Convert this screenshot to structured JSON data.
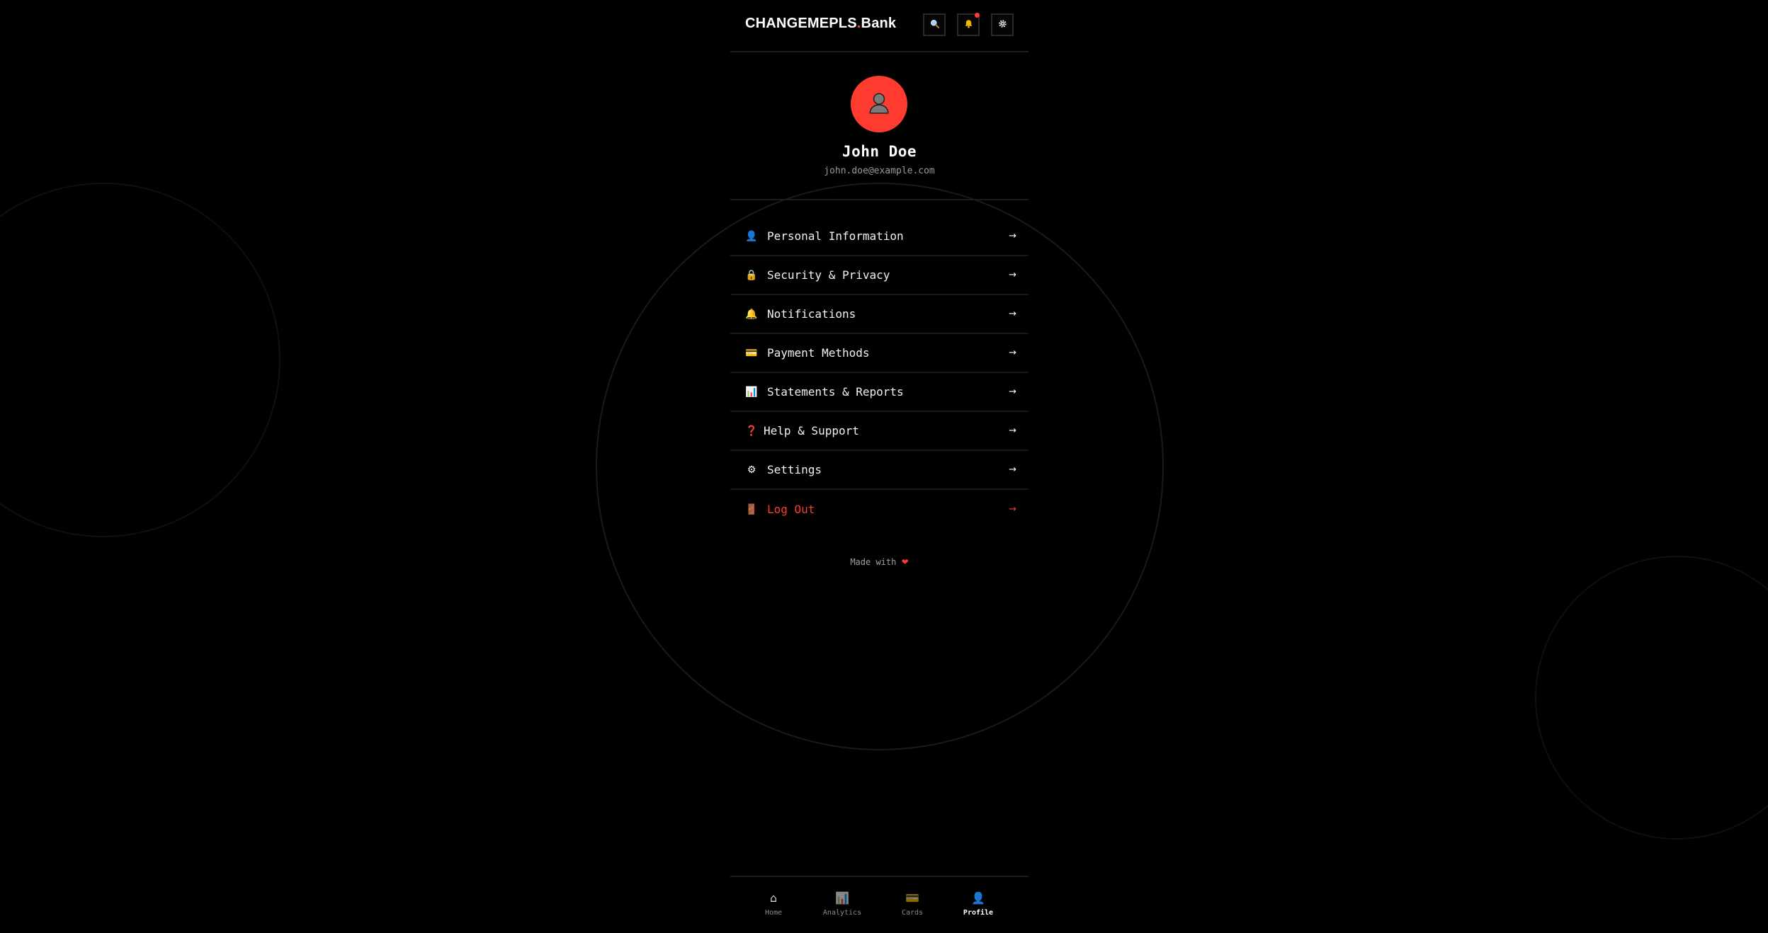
{
  "header": {
    "brand_main": "CHANGEMEPLS",
    "brand_dot": ".",
    "brand_suffix": "Bank",
    "search_icon": "search-icon",
    "notification_icon": "bell-icon",
    "settings_icon": "gear-icon"
  },
  "profile": {
    "name": "John Doe",
    "email": "john.doe@example.com",
    "avatar_icon": "user-silhouette-icon"
  },
  "menu": {
    "items": [
      {
        "label": "Personal Information",
        "icon": "user-icon",
        "glyph": "👤"
      },
      {
        "label": "Security & Privacy",
        "icon": "lock-icon",
        "glyph": "🔒"
      },
      {
        "label": "Notifications",
        "icon": "bell-icon",
        "glyph": "🔔"
      },
      {
        "label": "Payment Methods",
        "icon": "credit-card-icon",
        "glyph": "💳"
      },
      {
        "label": "Statements & Reports",
        "icon": "bar-chart-icon",
        "glyph": "📊"
      },
      {
        "label": "Help & Support",
        "icon": "question-icon",
        "glyph": "❓"
      },
      {
        "label": "Settings",
        "icon": "gear-icon",
        "glyph": "⚙"
      },
      {
        "label": "Log Out",
        "icon": "door-icon",
        "glyph": "🚪"
      }
    ],
    "arrow": "→"
  },
  "footer": {
    "made_with": "Made with",
    "heart": "❤"
  },
  "bottom_nav": {
    "tabs": [
      {
        "label": "Home",
        "icon": "home-icon",
        "glyph": "⌂"
      },
      {
        "label": "Analytics",
        "icon": "bar-chart-icon",
        "glyph": "📊"
      },
      {
        "label": "Cards",
        "icon": "credit-card-icon",
        "glyph": "💳"
      },
      {
        "label": "Profile",
        "icon": "user-icon",
        "glyph": "👤"
      }
    ],
    "active": "Profile"
  },
  "colors": {
    "background": "#000000",
    "accent": "#ff3b30",
    "muted_text": "#9a9a9a",
    "divider": "#1c1c1c"
  }
}
